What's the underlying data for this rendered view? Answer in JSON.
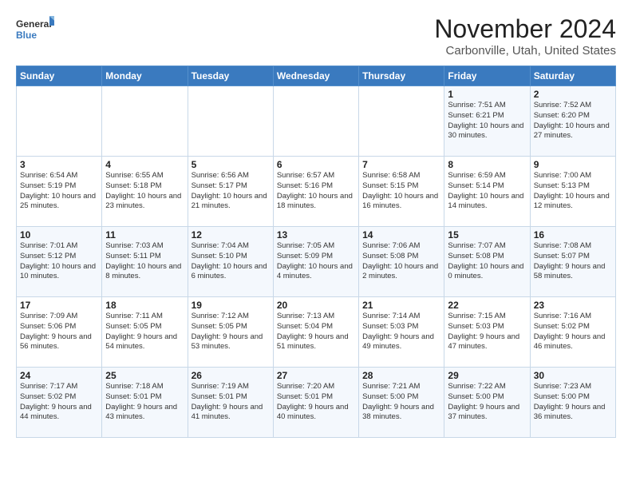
{
  "header": {
    "logo_general": "General",
    "logo_blue": "Blue",
    "month_title": "November 2024",
    "subtitle": "Carbonville, Utah, United States"
  },
  "weekdays": [
    "Sunday",
    "Monday",
    "Tuesday",
    "Wednesday",
    "Thursday",
    "Friday",
    "Saturday"
  ],
  "weeks": [
    [
      {
        "day": "",
        "info": ""
      },
      {
        "day": "",
        "info": ""
      },
      {
        "day": "",
        "info": ""
      },
      {
        "day": "",
        "info": ""
      },
      {
        "day": "",
        "info": ""
      },
      {
        "day": "1",
        "info": "Sunrise: 7:51 AM\nSunset: 6:21 PM\nDaylight: 10 hours and 30 minutes."
      },
      {
        "day": "2",
        "info": "Sunrise: 7:52 AM\nSunset: 6:20 PM\nDaylight: 10 hours and 27 minutes."
      }
    ],
    [
      {
        "day": "3",
        "info": "Sunrise: 6:54 AM\nSunset: 5:19 PM\nDaylight: 10 hours and 25 minutes."
      },
      {
        "day": "4",
        "info": "Sunrise: 6:55 AM\nSunset: 5:18 PM\nDaylight: 10 hours and 23 minutes."
      },
      {
        "day": "5",
        "info": "Sunrise: 6:56 AM\nSunset: 5:17 PM\nDaylight: 10 hours and 21 minutes."
      },
      {
        "day": "6",
        "info": "Sunrise: 6:57 AM\nSunset: 5:16 PM\nDaylight: 10 hours and 18 minutes."
      },
      {
        "day": "7",
        "info": "Sunrise: 6:58 AM\nSunset: 5:15 PM\nDaylight: 10 hours and 16 minutes."
      },
      {
        "day": "8",
        "info": "Sunrise: 6:59 AM\nSunset: 5:14 PM\nDaylight: 10 hours and 14 minutes."
      },
      {
        "day": "9",
        "info": "Sunrise: 7:00 AM\nSunset: 5:13 PM\nDaylight: 10 hours and 12 minutes."
      }
    ],
    [
      {
        "day": "10",
        "info": "Sunrise: 7:01 AM\nSunset: 5:12 PM\nDaylight: 10 hours and 10 minutes."
      },
      {
        "day": "11",
        "info": "Sunrise: 7:03 AM\nSunset: 5:11 PM\nDaylight: 10 hours and 8 minutes."
      },
      {
        "day": "12",
        "info": "Sunrise: 7:04 AM\nSunset: 5:10 PM\nDaylight: 10 hours and 6 minutes."
      },
      {
        "day": "13",
        "info": "Sunrise: 7:05 AM\nSunset: 5:09 PM\nDaylight: 10 hours and 4 minutes."
      },
      {
        "day": "14",
        "info": "Sunrise: 7:06 AM\nSunset: 5:08 PM\nDaylight: 10 hours and 2 minutes."
      },
      {
        "day": "15",
        "info": "Sunrise: 7:07 AM\nSunset: 5:08 PM\nDaylight: 10 hours and 0 minutes."
      },
      {
        "day": "16",
        "info": "Sunrise: 7:08 AM\nSunset: 5:07 PM\nDaylight: 9 hours and 58 minutes."
      }
    ],
    [
      {
        "day": "17",
        "info": "Sunrise: 7:09 AM\nSunset: 5:06 PM\nDaylight: 9 hours and 56 minutes."
      },
      {
        "day": "18",
        "info": "Sunrise: 7:11 AM\nSunset: 5:05 PM\nDaylight: 9 hours and 54 minutes."
      },
      {
        "day": "19",
        "info": "Sunrise: 7:12 AM\nSunset: 5:05 PM\nDaylight: 9 hours and 53 minutes."
      },
      {
        "day": "20",
        "info": "Sunrise: 7:13 AM\nSunset: 5:04 PM\nDaylight: 9 hours and 51 minutes."
      },
      {
        "day": "21",
        "info": "Sunrise: 7:14 AM\nSunset: 5:03 PM\nDaylight: 9 hours and 49 minutes."
      },
      {
        "day": "22",
        "info": "Sunrise: 7:15 AM\nSunset: 5:03 PM\nDaylight: 9 hours and 47 minutes."
      },
      {
        "day": "23",
        "info": "Sunrise: 7:16 AM\nSunset: 5:02 PM\nDaylight: 9 hours and 46 minutes."
      }
    ],
    [
      {
        "day": "24",
        "info": "Sunrise: 7:17 AM\nSunset: 5:02 PM\nDaylight: 9 hours and 44 minutes."
      },
      {
        "day": "25",
        "info": "Sunrise: 7:18 AM\nSunset: 5:01 PM\nDaylight: 9 hours and 43 minutes."
      },
      {
        "day": "26",
        "info": "Sunrise: 7:19 AM\nSunset: 5:01 PM\nDaylight: 9 hours and 41 minutes."
      },
      {
        "day": "27",
        "info": "Sunrise: 7:20 AM\nSunset: 5:01 PM\nDaylight: 9 hours and 40 minutes."
      },
      {
        "day": "28",
        "info": "Sunrise: 7:21 AM\nSunset: 5:00 PM\nDaylight: 9 hours and 38 minutes."
      },
      {
        "day": "29",
        "info": "Sunrise: 7:22 AM\nSunset: 5:00 PM\nDaylight: 9 hours and 37 minutes."
      },
      {
        "day": "30",
        "info": "Sunrise: 7:23 AM\nSunset: 5:00 PM\nDaylight: 9 hours and 36 minutes."
      }
    ]
  ]
}
